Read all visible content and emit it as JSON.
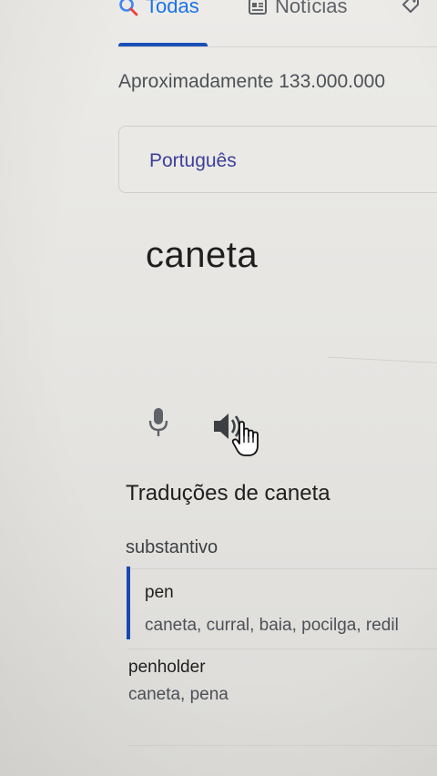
{
  "tabs": [
    {
      "label": "Todas",
      "icon": "search-icon",
      "active": true
    },
    {
      "label": "Notícias",
      "icon": "news-icon",
      "active": false
    },
    {
      "label": "",
      "icon": "tag-icon",
      "active": false
    }
  ],
  "results": {
    "count_text": "Aproximadamente 133.000.000"
  },
  "translator": {
    "source_language": "Português",
    "source_text": "caneta",
    "mic_icon": "microphone-icon",
    "speaker_icon": "speaker-icon"
  },
  "translations": {
    "heading": "Traduções de caneta",
    "part_of_speech": "substantivo",
    "entries": [
      {
        "word": "pen",
        "synonyms": "caneta, curral, baia, pocilga, redil"
      },
      {
        "word": "penholder",
        "synonyms": "caneta, pena"
      }
    ]
  },
  "colors": {
    "accent": "#1a73e8",
    "tab_underline": "#1a4fb8",
    "entry_accent": "#1a47b0",
    "language_text": "#3c3f9a"
  }
}
